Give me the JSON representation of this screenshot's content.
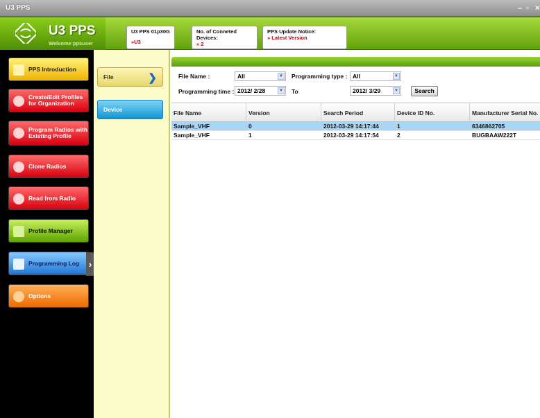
{
  "window": {
    "title": "U3 PPS",
    "controls": [
      "–",
      "▫",
      "×"
    ]
  },
  "header": {
    "app_name": "U3 PPS",
    "welcome": "Welcome ppsuser",
    "info": [
      {
        "label": "U3 PPS 01p30G",
        "value": "»U3"
      },
      {
        "label": "No. of Conneted Devices:",
        "value": "» 2"
      },
      {
        "label": "PPS Update Notice:",
        "value": "» Latest Version"
      }
    ]
  },
  "nav": [
    {
      "label": "PPS Introduction",
      "color": "#f0b300",
      "icon": "document-icon"
    },
    {
      "label": "Create/Edit Profiles for Organization",
      "color": "#d8000f",
      "icon": "radio-icon"
    },
    {
      "label": "Program Radios with Existing Profile",
      "color": "#d8000f",
      "icon": "radio-icon"
    },
    {
      "label": "Clone Radios",
      "color": "#d8000f",
      "icon": "radio-icon"
    },
    {
      "label": "Read from Radio",
      "color": "#d8000f",
      "icon": "radio-icon"
    },
    {
      "label": "Profile Manager",
      "color": "#5ea400",
      "icon": "folder-icon"
    },
    {
      "label": "Programming Log",
      "color": "#1f76d4",
      "icon": "log-icon",
      "active": true
    },
    {
      "label": "Options",
      "color": "#ec6a00",
      "icon": "gear-icon"
    }
  ],
  "subnav": {
    "file": "File",
    "device": "Device"
  },
  "filters": {
    "file_name_label": "File Name :",
    "file_name_value": "All",
    "programming_type_label": "Programming type :",
    "programming_type_value": "All",
    "programming_time_label": "Programming time :",
    "from_date": "2012/ 2/28",
    "to_label": "To",
    "to_date": "2012/ 3/29",
    "search_label": "Search"
  },
  "table": {
    "columns": [
      "File Name",
      "Version",
      "Search Period",
      "Device ID No.",
      "Manufacturer Serial No."
    ],
    "rows": [
      {
        "file_name": "Sample_VHF",
        "version": "0",
        "period": "2012-03-29 14:17:44",
        "device_id": "1",
        "serial": "6346862705",
        "selected": true
      },
      {
        "file_name": "Sample_VHF",
        "version": "1",
        "period": "2012-03-29 14:17:54",
        "device_id": "2",
        "serial": "BUGBAAW222T"
      }
    ]
  }
}
